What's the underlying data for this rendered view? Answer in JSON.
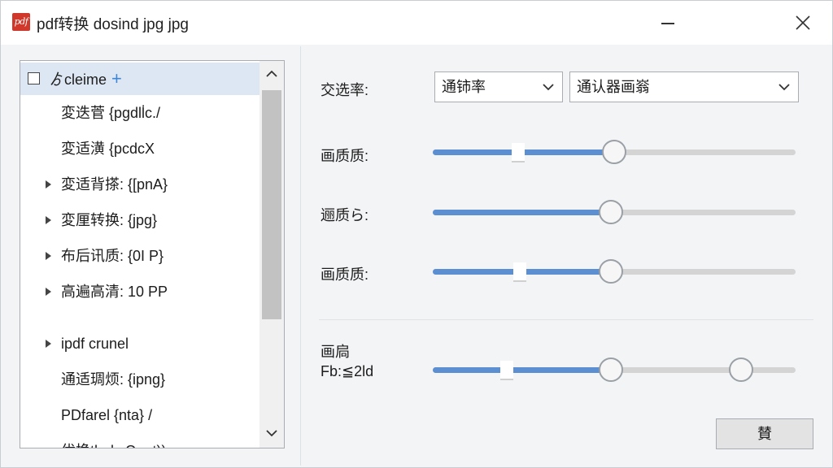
{
  "window": {
    "title": "pdf转换 dosind jpg jpg",
    "icon_label": "pdf"
  },
  "tree": {
    "header": {
      "label": "ゟcleime",
      "checked": false
    },
    "items": [
      {
        "label": "変迭菅 {pgdll̇c./",
        "expandable": false
      },
      {
        "label": "変适潢 {pcdcX",
        "expandable": false
      },
      {
        "label": "変适背搽: {[pnA}",
        "expandable": true
      },
      {
        "label": "変厘转换: {jpg}",
        "expandable": true
      },
      {
        "label": "布后讯质: {0I P}",
        "expandable": true
      },
      {
        "label": "高遍高清: 10 PP",
        "expandable": true
      },
      {
        "label": "ipdf crunel",
        "expandable": true
      },
      {
        "label": "通适琱烦: {ipng}",
        "expandable": false
      },
      {
        "label": "PDfarel {nta} /",
        "expandable": false
      },
      {
        "label": "优换thels.Ωpot))",
        "expandable": false
      }
    ]
  },
  "settings": {
    "select_label": "交选率:",
    "select_primary": "通铈率",
    "select_secondary": "通认器画嵡",
    "sliders": [
      {
        "label": "画质质:",
        "value": 0.5,
        "marker": 0.235
      },
      {
        "label": "逦质ら:",
        "value": 0.49,
        "marker": null
      },
      {
        "label": "画质质:",
        "value": 0.49,
        "marker": 0.24
      }
    ],
    "range": {
      "label_line1": "画扃",
      "label_line2": "Fb:≦2ld",
      "low": 0.49,
      "high": 0.85,
      "marker": 0.205
    },
    "action_label": "賛"
  },
  "colors": {
    "accent": "#5b8fd1",
    "title_icon": "#d0382b",
    "selection": "#dde7f3"
  }
}
